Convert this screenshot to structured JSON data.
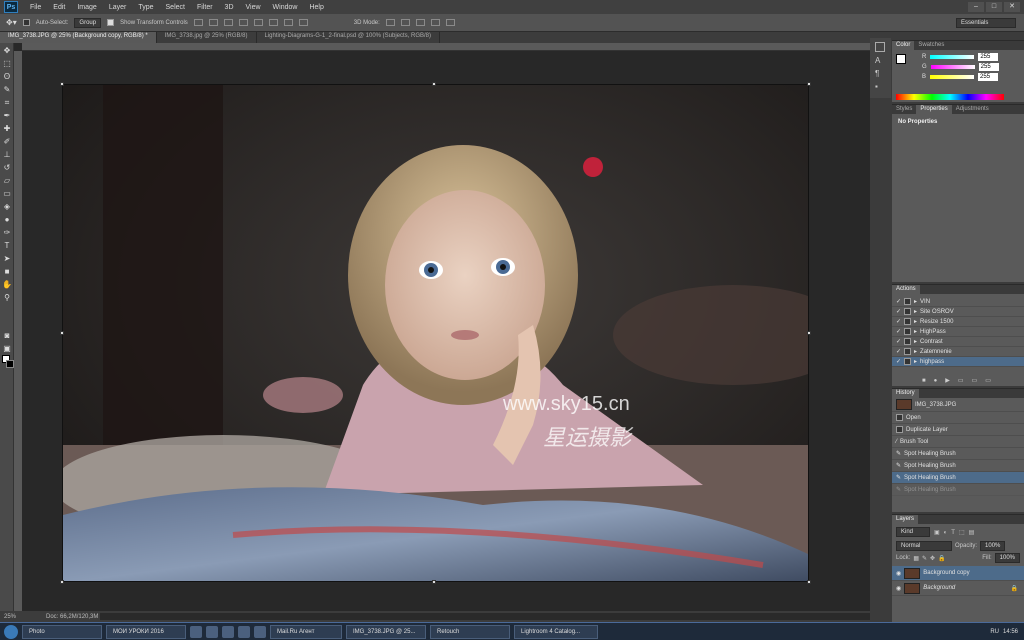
{
  "menu": [
    "File",
    "Edit",
    "Image",
    "Layer",
    "Type",
    "Select",
    "Filter",
    "3D",
    "View",
    "Window",
    "Help"
  ],
  "options": {
    "auto_select_label": "Auto-Select:",
    "group_value": "Group",
    "show_transform_label": "Show Transform Controls",
    "mode_3d_label": "3D Mode:",
    "workspace": "Essentials"
  },
  "tabs": [
    "IMG_3738.JPG @ 25% (Background copy, RGB/8) *",
    "IMG_3738.jpg @ 25% (RGB/8)",
    "Lighting-Diagrams-G-1_2-final.psd @ 100% (Subjects, RGB/8)"
  ],
  "watermark": {
    "url": "www.sky15.cn",
    "cn": "星运摄影"
  },
  "status": {
    "zoom": "25%",
    "doc": "Doc: 66,2M/120,3M"
  },
  "color_panel": {
    "tabs": [
      "Color",
      "Swatches"
    ],
    "r_label": "R",
    "g_label": "G",
    "b_label": "B",
    "r": "255",
    "g": "255",
    "b": "255"
  },
  "properties_panel": {
    "tabs": [
      "Styles",
      "Properties",
      "Adjustments"
    ],
    "text": "No Properties"
  },
  "actions_panel": {
    "title": "Actions",
    "items": [
      "VIN",
      "Site OSROV",
      "Resize 1500",
      "HighPass",
      "Contrast",
      "Zatemnenie",
      "highpass"
    ]
  },
  "history_panel": {
    "title": "History",
    "snapshot": "IMG_3738.JPG",
    "items": [
      "Open",
      "Duplicate Layer",
      "Brush Tool",
      "Spot Healing Brush",
      "Spot Healing Brush",
      "Spot Healing Brush",
      "Spot Healing Brush"
    ]
  },
  "layers_panel": {
    "title": "Layers",
    "kind_label": "Kind",
    "blend": "Normal",
    "opacity_label": "Opacity:",
    "opacity": "100%",
    "lock_label": "Lock:",
    "fill_label": "Fill:",
    "fill": "100%",
    "layers": [
      "Background copy",
      "Background"
    ]
  },
  "taskbar": {
    "items": [
      "Photo",
      "МОИ УРОКИ 2016",
      "Mail.Ru Агент",
      "IMG_3738.JPG @ 25...",
      "Retouch",
      "Lightroom 4 Catalog..."
    ],
    "lang": "RU",
    "time": "14:56"
  }
}
